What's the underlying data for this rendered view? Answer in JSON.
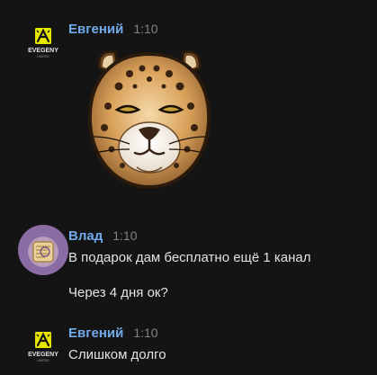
{
  "messages": [
    {
      "author": "Евгений",
      "time": "1:10",
      "avatar": {
        "icon": "evgeny-logo-icon",
        "label": "EVEGENY",
        "sublabel": "LIMITED"
      },
      "sticker": "leopard-sticker-icon"
    },
    {
      "author": "Влад",
      "time": "1:10",
      "avatar": {
        "icon": "vlad-avatar-icon"
      },
      "lines": [
        "В подарок дам бесплатно ещё 1 канал",
        "Через 4 дня ок?"
      ]
    },
    {
      "author": "Евгений",
      "time": "1:10",
      "avatar": {
        "icon": "evgeny-logo-icon",
        "label": "EVEGENY",
        "sublabel": "LIMITED"
      },
      "lines": [
        "Слишком долго"
      ]
    }
  ],
  "colors": {
    "background": "#141414",
    "author": "#71aaeb",
    "time": "#828282",
    "text": "#e1e3e6",
    "logo_yellow": "#e6e600"
  }
}
